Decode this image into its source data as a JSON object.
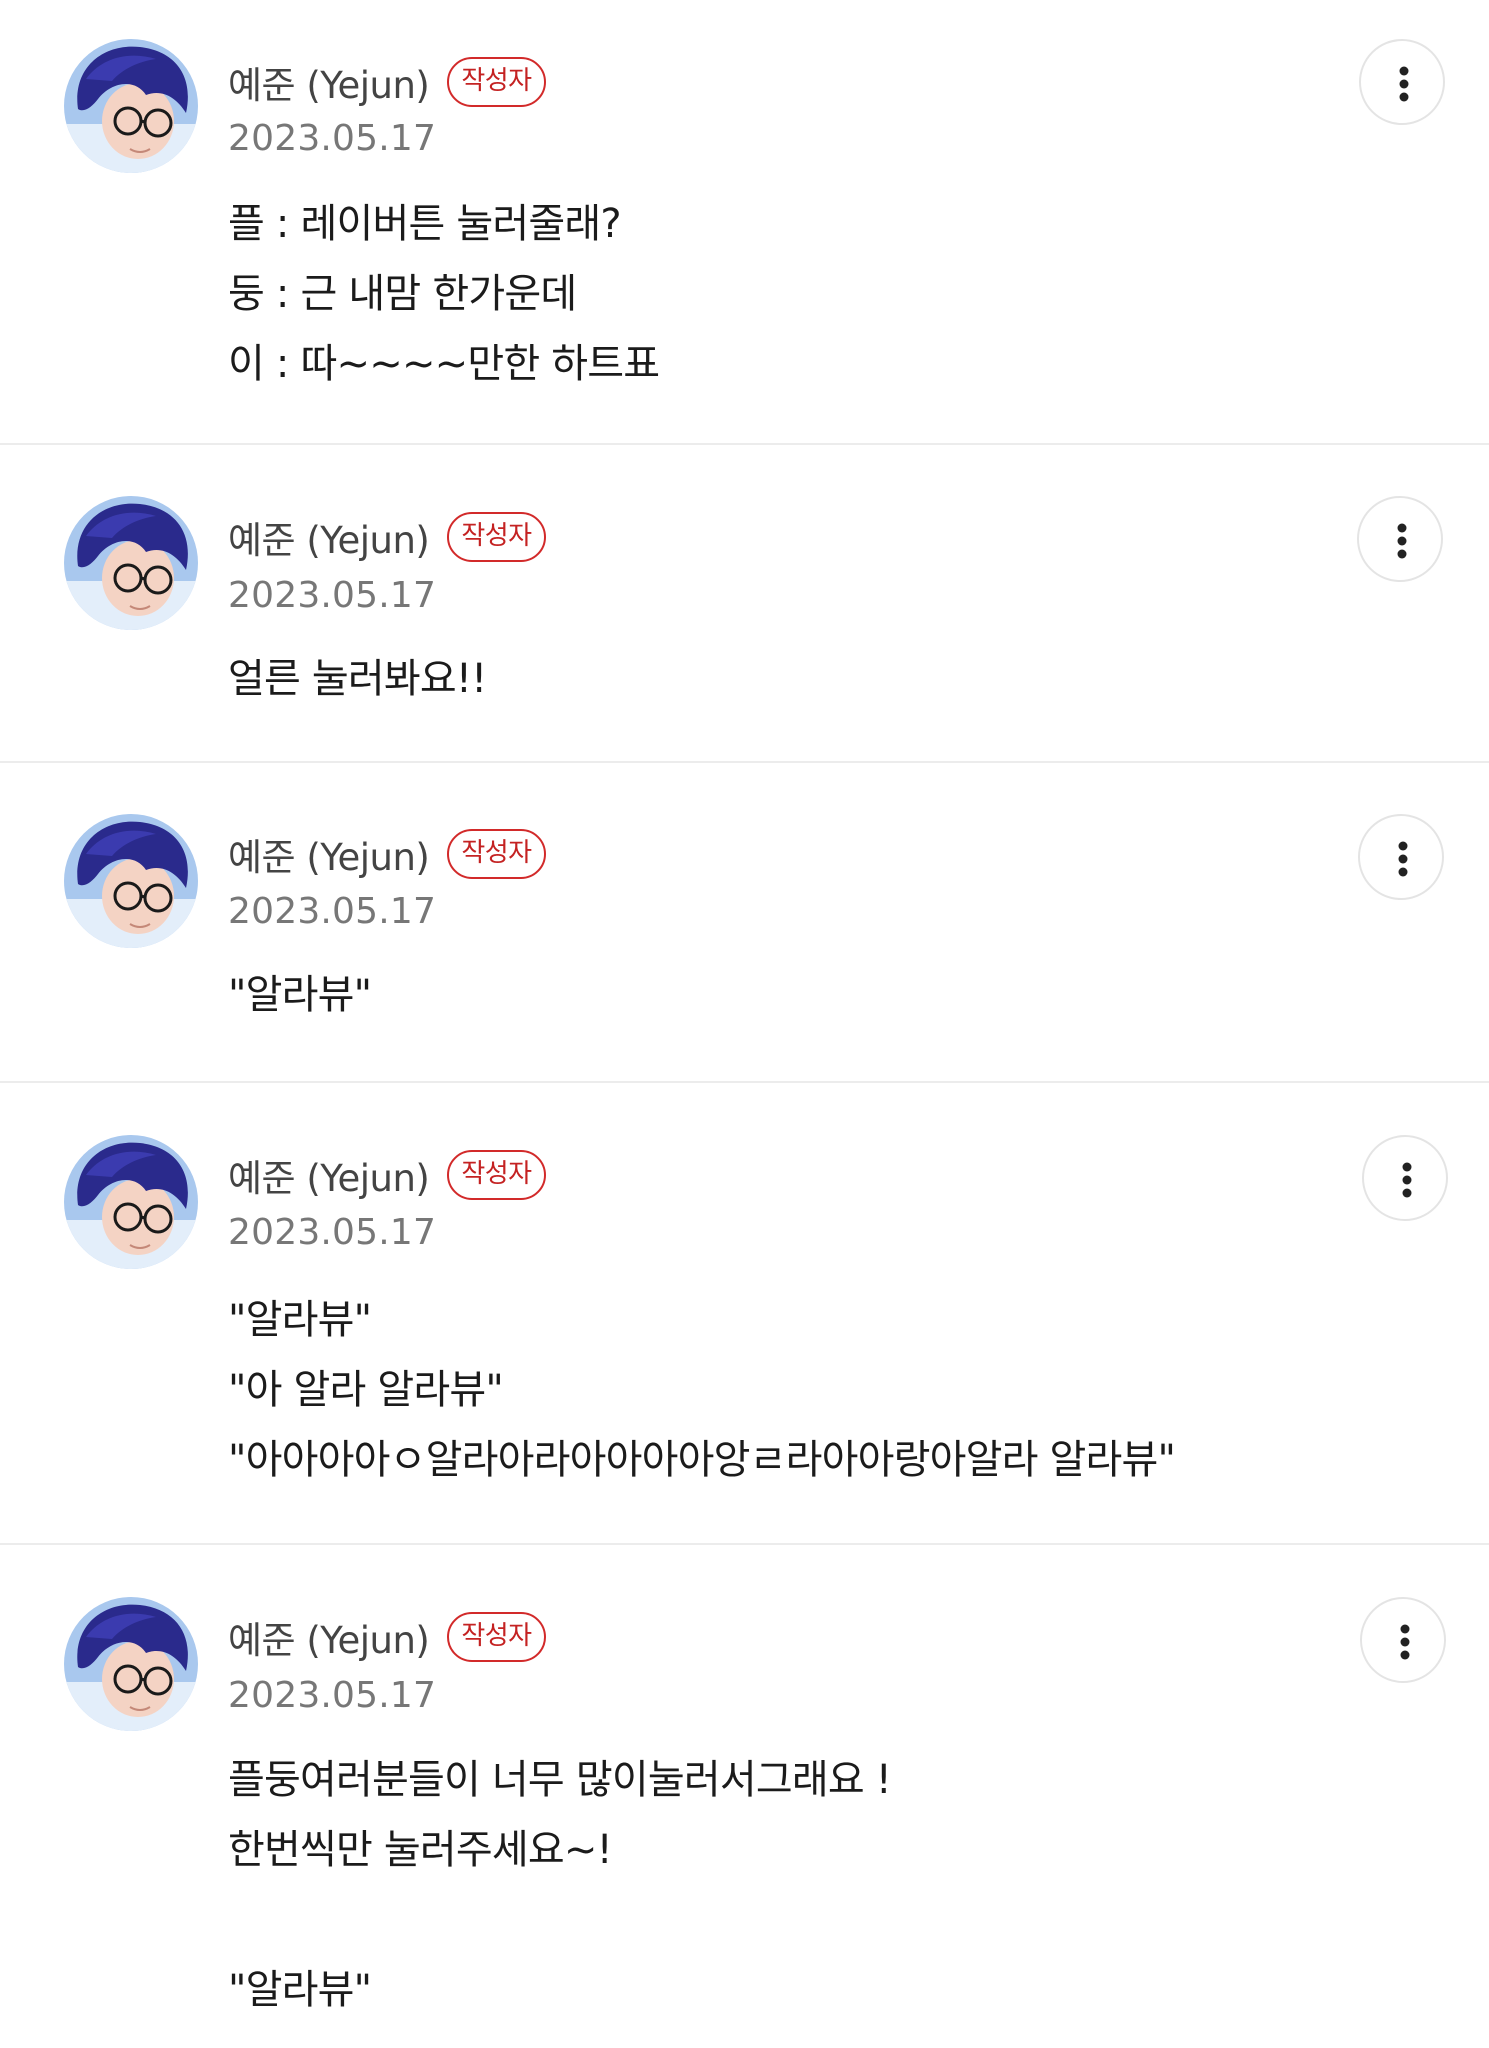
{
  "comments": [
    {
      "author": "예준 (Yejun)",
      "badge": "작성자",
      "date": "2023.05.17",
      "lines": [
        "플 : 레이버튼 눌러줄래?",
        "둥 : 근 내맘 한가운데",
        "이 : 따~~~~만한 하트표"
      ]
    },
    {
      "author": "예준 (Yejun)",
      "badge": "작성자",
      "date": "2023.05.17",
      "lines": [
        "얼른 눌러봐요!!"
      ]
    },
    {
      "author": "예준 (Yejun)",
      "badge": "작성자",
      "date": "2023.05.17",
      "lines": [
        "\"알라뷰\""
      ]
    },
    {
      "author": "예준 (Yejun)",
      "badge": "작성자",
      "date": "2023.05.17",
      "lines": [
        "\"알라뷰\"",
        "\"아 알라 알라뷰\"",
        "\"아아아아ㅇ알라아라아아아아앙ㄹ라아아랑아알라 알라뷰\""
      ]
    },
    {
      "author": "예준 (Yejun)",
      "badge": "작성자",
      "date": "2023.05.17",
      "lines": [
        "플둥여러분들이 너무 많이눌러서그래요 !",
        "한번씩만 눌러주세요~!",
        "",
        "\"알라뷰\""
      ]
    }
  ],
  "icons": {
    "more": "more-vertical-icon",
    "avatar": "avatar-illustration"
  },
  "colors": {
    "badge": "#d22a2a",
    "date": "#777777",
    "divider": "#ececec"
  }
}
